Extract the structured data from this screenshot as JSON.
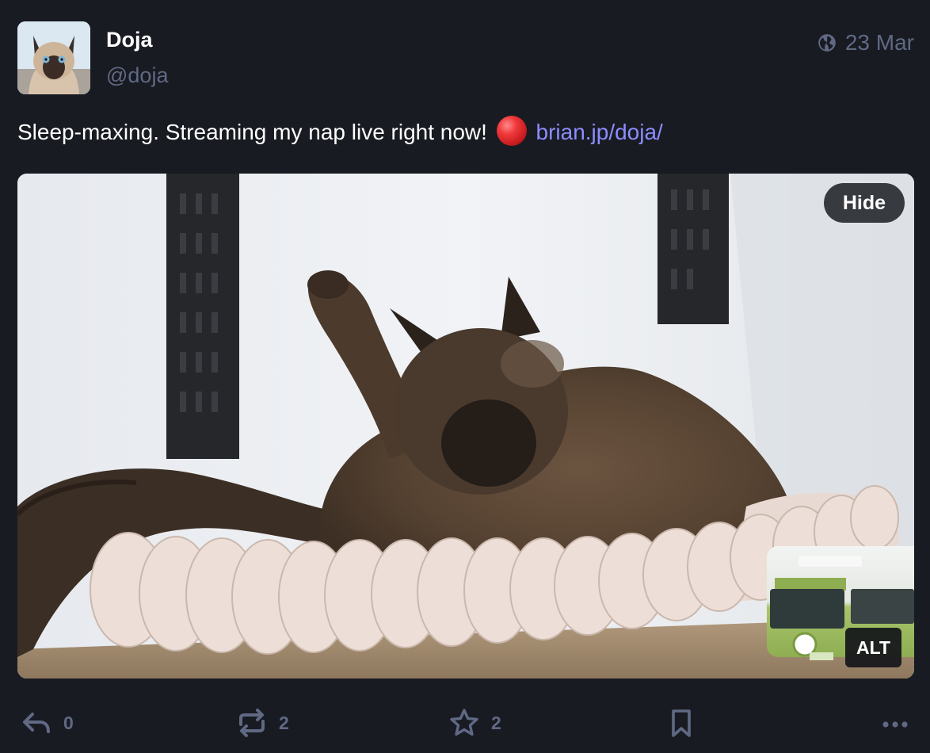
{
  "author": {
    "display_name": "Doja",
    "handle": "@doja",
    "avatar_icon": "cat-avatar"
  },
  "meta": {
    "visibility_icon": "globe-icon",
    "date": "23 Mar"
  },
  "post": {
    "text": "Sleep-maxing. Streaming my nap live right now!",
    "emoji": "red-circle",
    "link_text": "brian.jp/doja/"
  },
  "media": {
    "hide_label": "Hide",
    "alt_label": "ALT"
  },
  "actions": {
    "reply_count": "0",
    "boost_count": "2",
    "favourite_count": "2"
  },
  "colors": {
    "background": "#191b22",
    "muted": "#606984",
    "link": "#8c8dff"
  }
}
